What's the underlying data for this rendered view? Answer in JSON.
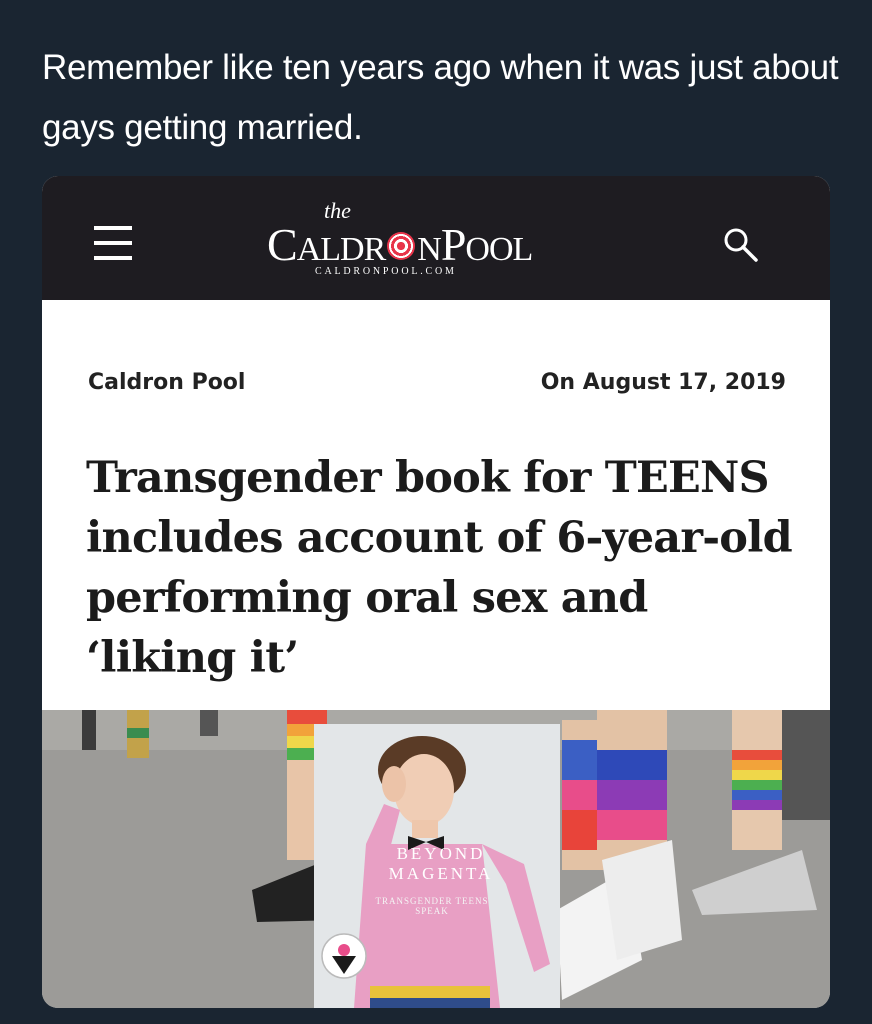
{
  "tweet": {
    "text": "Remember like ten years ago when it was just about gays getting married."
  },
  "site": {
    "logo_the": "the",
    "logo_part1": "C",
    "logo_part2": "ALDR",
    "logo_part3": "N",
    "logo_part4": "P",
    "logo_part5": "OOL",
    "logo_url": "CALDRONPOOL.COM",
    "menu_icon": "hamburger-icon",
    "search_icon": "search-icon"
  },
  "article": {
    "author": "Caldron Pool",
    "date": "On August 17, 2019",
    "headline": "Transgender book for TEENS includes account of 6-year-old performing oral sex and ‘liking it’"
  },
  "book_cover": {
    "title": "BEYOND MAGENTA",
    "subtitle": "TRANSGENDER TEENS SPEAK"
  },
  "colors": {
    "background": "#1a2531",
    "header": "#1e1c21",
    "logo_accent": "#e8344a"
  }
}
